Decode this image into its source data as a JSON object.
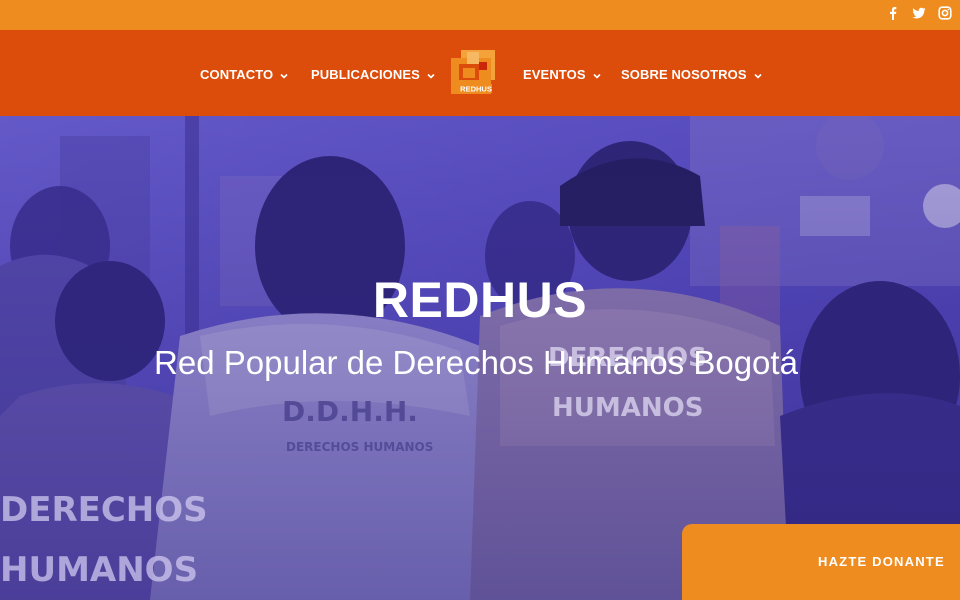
{
  "header": {
    "social": [
      "facebook-icon",
      "twitter-icon",
      "instagram-icon"
    ],
    "top_bar_color": "#ee8c1f",
    "nav_color": "#dc4c0a"
  },
  "nav": {
    "contacto": "CONTACTO",
    "publicaciones": "PUBLICACIONES",
    "eventos": "EVENTOS",
    "sobre_nosotros": "SOBRE NOSOTROS",
    "logo_text": "REDHUS"
  },
  "hero": {
    "title": "REDHUS",
    "subtitle": "Red Popular de Derechos Humanos Bogotá",
    "vest_texts": [
      "DERECHOS",
      "HUMANOS",
      "D.D.H.H.",
      "DERECHOS HUMANOS",
      "DERECHOS",
      "HUMANOS"
    ],
    "overlay_color": "#5a4fd0"
  },
  "donate": {
    "label": "HAZTE DONANTE",
    "color": "#ee8c1f"
  }
}
